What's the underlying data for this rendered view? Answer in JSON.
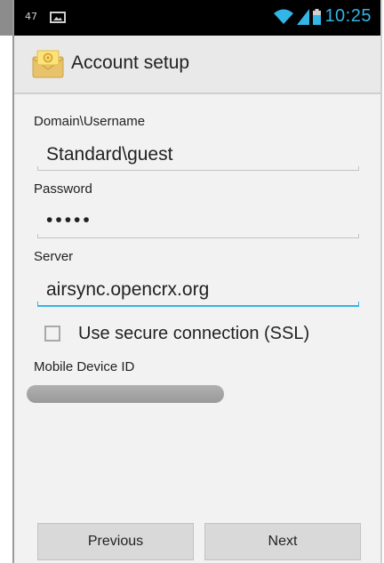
{
  "status_bar": {
    "notification_count": "47",
    "notification_icon": "image-notification-icon",
    "wifi_icon": "wifi-icon",
    "signal_icon": "signal-icon",
    "battery_icon": "battery-icon",
    "time": "10:25",
    "accent_color": "#33b5e5"
  },
  "title_bar": {
    "icon": "email-app-icon",
    "title": "Account setup"
  },
  "form": {
    "domain_username": {
      "label": "Domain\\Username",
      "value": "Standard\\guest"
    },
    "password": {
      "label": "Password",
      "value": "•••••"
    },
    "server": {
      "label": "Server",
      "value": "airsync.opencrx.org"
    },
    "ssl": {
      "label": "Use secure connection (SSL)",
      "checked": false
    },
    "mobile_device_id": {
      "label": "Mobile Device ID",
      "value_redacted": true
    }
  },
  "buttons": {
    "previous": "Previous",
    "next": "Next"
  }
}
